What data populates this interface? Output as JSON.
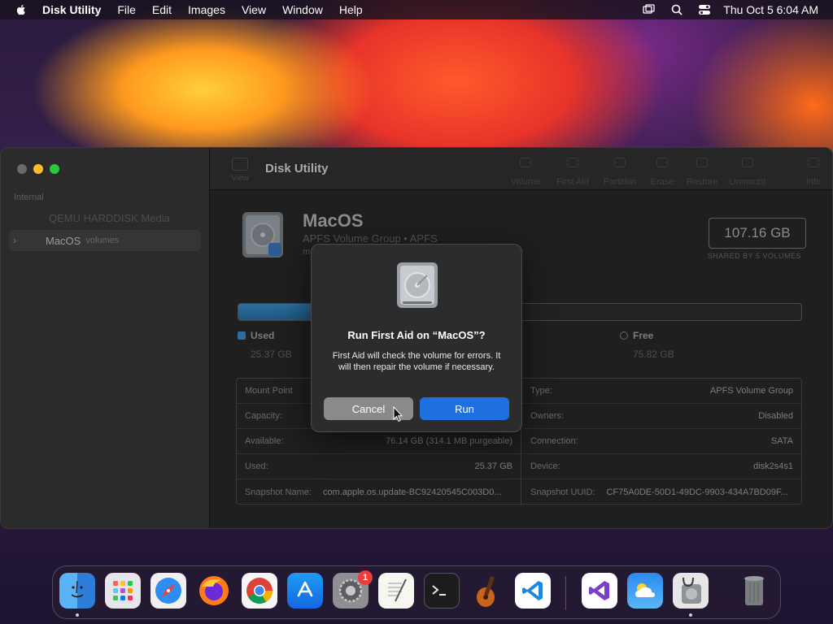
{
  "menubar": {
    "app_name": "Disk Utility",
    "items": [
      "File",
      "Edit",
      "Images",
      "View",
      "Window",
      "Help"
    ],
    "clock": "Thu Oct 5  6:04 AM"
  },
  "window": {
    "title": "Disk Utility",
    "view_label": "View",
    "toolbar": [
      "Volume",
      "First Aid",
      "Partition",
      "Erase",
      "Restore",
      "Unmount",
      "Info"
    ],
    "sidebar": {
      "section": "Internal",
      "items": [
        {
          "label": "QEMU HARDDISK Media",
          "sub": ""
        },
        {
          "label": "MacOS",
          "sub": "volumes"
        }
      ]
    },
    "volume": {
      "name": "MacOS",
      "subtitle": "APFS Volume Group • APFS",
      "subtitle2": "m",
      "size": "107.16 GB",
      "size_caption": "SHARED BY 5 VOLUMES",
      "used_label": "Used",
      "used_value": "25.37 GB",
      "free_label": "Free",
      "free_value": "75.82 GB",
      "used_fraction": 0.237
    },
    "info_left": [
      {
        "key": "Mount Point",
        "value": "/"
      },
      {
        "key": "Capacity:",
        "value": ""
      },
      {
        "key": "Available:",
        "value": "76.14 GB (314.1 MB purgeable)"
      },
      {
        "key": "Used:",
        "value": "25.37 GB"
      },
      {
        "key": "Snapshot Name:",
        "value": "com.apple.os.update-BC92420545C003D0..."
      }
    ],
    "info_right": [
      {
        "key": "Type:",
        "value": "APFS Volume Group"
      },
      {
        "key": "Owners:",
        "value": "Disabled"
      },
      {
        "key": "Connection:",
        "value": "SATA"
      },
      {
        "key": "Device:",
        "value": "disk2s4s1"
      },
      {
        "key": "Snapshot UUID:",
        "value": "CF75A0DE-50D1-49DC-9903-434A7BD09F..."
      }
    ]
  },
  "dialog": {
    "title": "Run First Aid on “MacOS”?",
    "message": "First Aid will check the volume for errors. It will then repair the volume if necessary.",
    "cancel": "Cancel",
    "run": "Run"
  },
  "dock": {
    "apps": [
      "finder-icon",
      "launchpad-icon",
      "safari-icon",
      "firefox-icon",
      "chrome-icon",
      "app-store-icon",
      "system-settings-icon",
      "textedit-icon",
      "terminal-icon",
      "garageband-icon",
      "vscode-icon",
      "visual-studio-icon",
      "weather-icon",
      "disk-utility-icon",
      "trash-icon"
    ],
    "settings_badge": "1"
  },
  "colors": {
    "accent": "#1e6fe0",
    "used": "#2c6e9b",
    "window_bg": "#1e1e1e"
  }
}
